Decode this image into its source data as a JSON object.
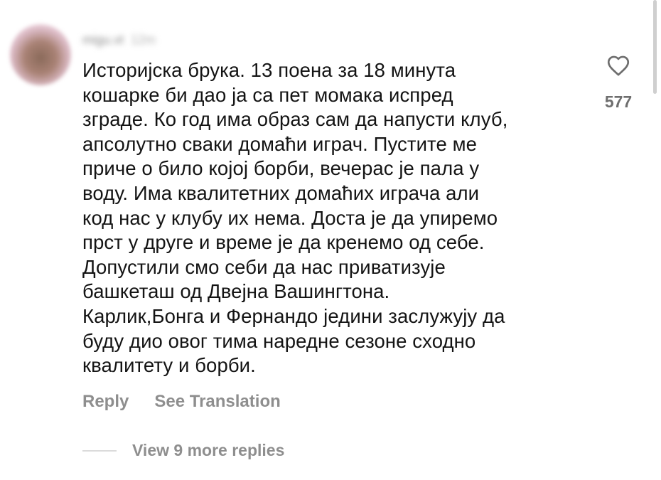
{
  "comment": {
    "username": "migu.vt",
    "time": "12m",
    "lines": [
      "Историјска брука. 13 поена за 18 минута",
      "кошарке би дао ја са пет момака испред",
      "зграде. Ко год има образ сам да напусти клуб,",
      "апсолутно сваки домаћи играч. Пустите ме",
      "приче о било којој борби, вечерас је пала у",
      "воду. Има квалитетних домаћих играча али",
      "код нас у клубу их нема. Доста је да упиремо",
      "прст у друге и време је да кренемо од себе.",
      "Допустили смо себи да нас приватизује",
      "башкеташ од Двејна Вашингтона.",
      "Карлик,Бонга и Фернандо једини заслужују да",
      "буду дио овог тима наредне сезоне сходно",
      "квалитету и борби."
    ],
    "like_count": "577",
    "reply_label": "Reply",
    "translate_label": "See Translation",
    "more_replies_label": "View 9 more replies"
  },
  "icons": {
    "like": "heart-outline-icon",
    "avatar": "user-avatar"
  },
  "colors": {
    "text": "#141414",
    "secondary": "#8e8e8e",
    "divider": "#dbdbdb",
    "background": "#ffffff"
  }
}
